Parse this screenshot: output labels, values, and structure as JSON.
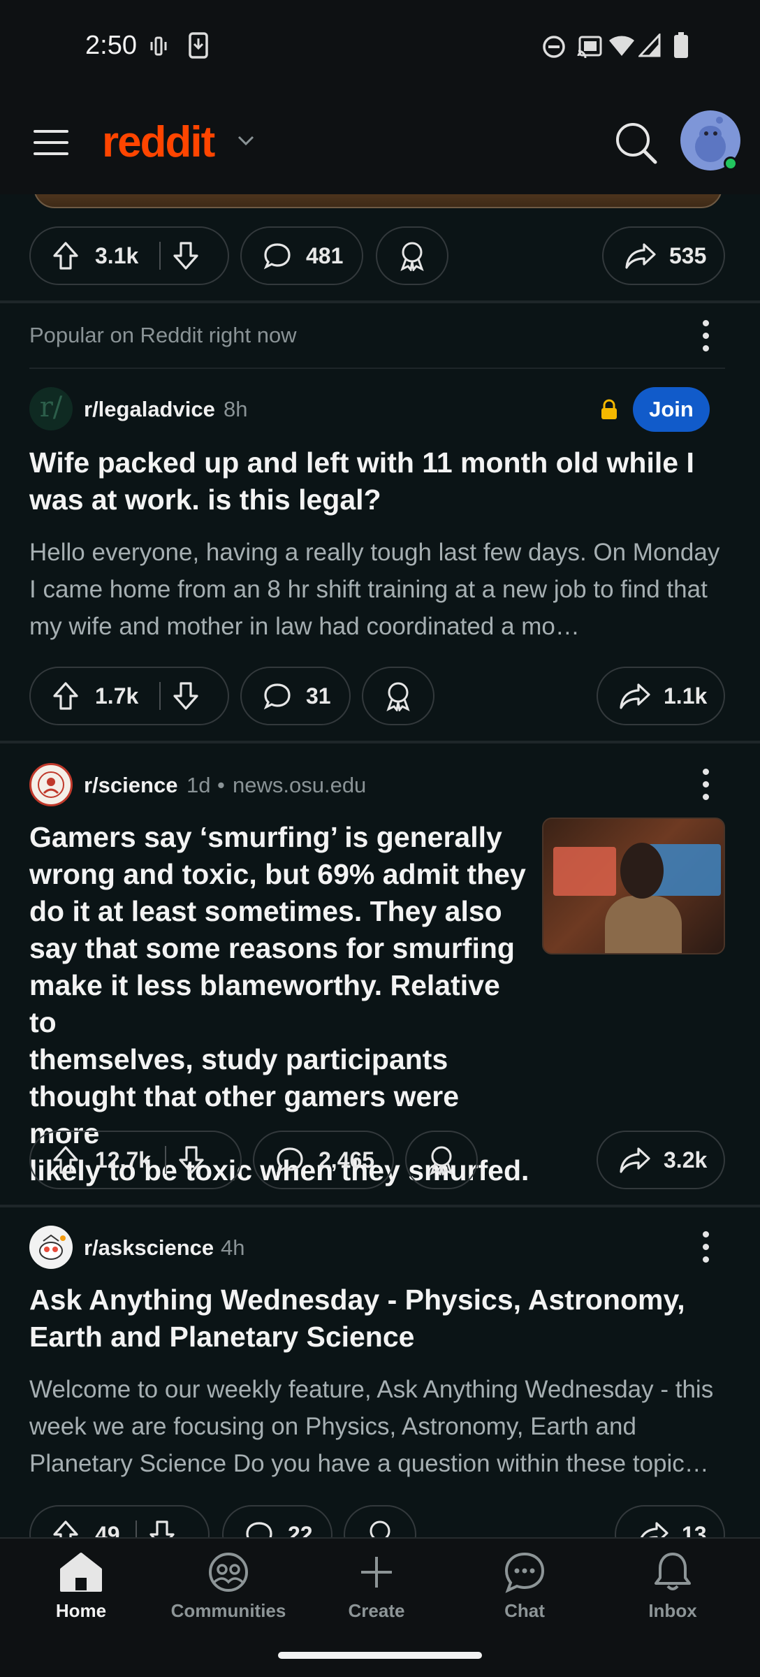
{
  "status_bar": {
    "time": "2:50"
  },
  "header": {
    "logo_text": "reddit",
    "accent_color": "#ff4500"
  },
  "prev_post": {
    "upvotes": "3.1k",
    "comments": "481",
    "shares": "535"
  },
  "section_label": "Popular on Reddit right now",
  "posts": [
    {
      "subreddit": "r/legaladvice",
      "age": "8h",
      "join_label": "Join",
      "title_lines": [
        "Wife packed up and left with 11 month old while I",
        "was at work. is this legal?"
      ],
      "body": "Hello everyone, having a really tough last few days. On Monday I came home from an 8 hr shift training at a new job to find that my wife and mother in law had coordinated a mo…",
      "upvotes": "1.7k",
      "comments": "31",
      "shares": "1.1k"
    },
    {
      "subreddit": "r/science",
      "age": "1d",
      "domain": "news.osu.edu",
      "title_lines": [
        "Gamers say ‘smurfing’ is generally",
        "wrong and toxic, but 69% admit they",
        "do it at least sometimes. They also",
        "say that some reasons for smurfing",
        "make it less blameworthy. Relative to",
        "themselves, study participants",
        "thought that other gamers were more",
        "likely to be toxic when they smurfed."
      ],
      "upvotes": "12.7k",
      "comments": "2,465",
      "shares": "3.2k"
    },
    {
      "subreddit": "r/askscience",
      "age": "4h",
      "title_lines": [
        "Ask Anything Wednesday - Physics, Astronomy,",
        "Earth and Planetary Science"
      ],
      "body": "Welcome to our weekly feature, Ask Anything Wednesday - this week we are focusing on Physics, Astronomy, Earth and Planetary Science Do you have a question within these topic…",
      "upvotes": "49",
      "comments": "22",
      "shares": "13"
    }
  ],
  "bottom_nav": [
    {
      "label": "Home",
      "icon": "home-icon",
      "active": true
    },
    {
      "label": "Communities",
      "icon": "communities-icon"
    },
    {
      "label": "Create",
      "icon": "plus-icon"
    },
    {
      "label": "Chat",
      "icon": "chat-icon"
    },
    {
      "label": "Inbox",
      "icon": "bell-icon"
    }
  ]
}
